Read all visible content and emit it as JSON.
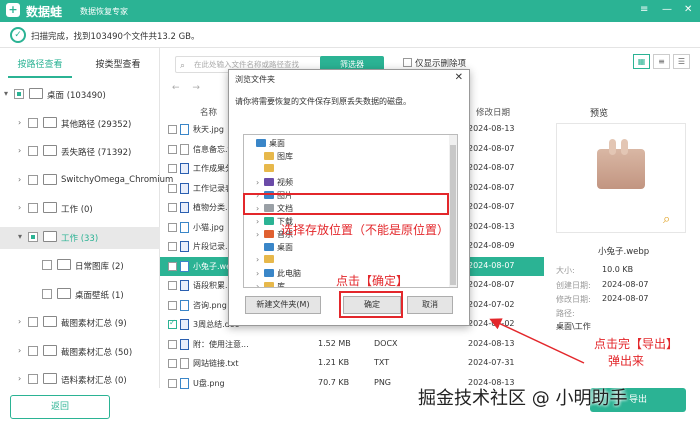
{
  "titlebar": {
    "logo_glyph": "+",
    "app_name": "数据蛙",
    "app_subtitle": "数据恢复专家",
    "controls": [
      "≡",
      "—",
      "✕"
    ]
  },
  "status": {
    "text": "扫描完成，找到103490个文件共13.2 GB。"
  },
  "tabs": [
    "按路径查看",
    "按类型查看"
  ],
  "tree": [
    {
      "label": "桌面 (103490)",
      "expand": "▾",
      "level": 0
    },
    {
      "label": "其他路径 (29352)",
      "expand": "›",
      "level": 1
    },
    {
      "label": "丢失路径 (71392)",
      "expand": "›",
      "level": 1
    },
    {
      "label": "SwitchyOmega_Chromium",
      "expand": "›",
      "level": 1
    },
    {
      "label": "工作 (0)",
      "expand": "›",
      "level": 1
    },
    {
      "label": "工作 (33)",
      "expand": "▾",
      "level": 1,
      "selected": true
    },
    {
      "label": "日常图库 (2)",
      "expand": "",
      "level": 2
    },
    {
      "label": "桌面壁纸 (1)",
      "expand": "",
      "level": 2
    },
    {
      "label": "截图素材汇总 (9)",
      "expand": "›",
      "level": 1
    },
    {
      "label": "截图素材汇总 (50)",
      "expand": "›",
      "level": 1
    },
    {
      "label": "语料素材汇总 (0)",
      "expand": "›",
      "level": 1
    }
  ],
  "back_button": "返回",
  "search": {
    "placeholder": "在此处输入文件名称或路径查找"
  },
  "filter_button": "筛选器",
  "only_deleted": "仅显示删除项",
  "nav": {
    "back": "←",
    "forward": "→"
  },
  "columns": {
    "name": "名称",
    "date": "修改日期"
  },
  "files": [
    {
      "name": "秋天.jpg",
      "size": "",
      "type": "",
      "date": "2024-08-13",
      "checked": false,
      "icon": "img"
    },
    {
      "name": "信息备忘.t",
      "size": "",
      "type": "",
      "date": "2024-08-07",
      "checked": false,
      "icon": "txt"
    },
    {
      "name": "工作成果分",
      "size": "",
      "type": "",
      "date": "2024-08-07",
      "checked": false,
      "icon": "doc"
    },
    {
      "name": "工作记录表",
      "size": "",
      "type": "",
      "date": "2024-08-07",
      "checked": false,
      "icon": "doc"
    },
    {
      "name": "植物分类.d",
      "size": "",
      "type": "",
      "date": "2024-08-07",
      "checked": false,
      "icon": "doc"
    },
    {
      "name": "小猫.jpg",
      "size": "",
      "type": "",
      "date": "2024-08-13",
      "checked": false,
      "icon": "img"
    },
    {
      "name": "片段记录.d",
      "size": "",
      "type": "",
      "date": "2024-08-09",
      "checked": false,
      "icon": "doc"
    },
    {
      "name": "小兔子.web",
      "size": "",
      "type": "",
      "date": "2024-08-07",
      "checked": false,
      "icon": "img",
      "selected": true
    },
    {
      "name": "语段积累.d",
      "size": "",
      "type": "",
      "date": "2024-08-07",
      "checked": false,
      "icon": "doc"
    },
    {
      "name": "咨询.png",
      "size": "",
      "type": "",
      "date": "2024-07-02",
      "checked": false,
      "icon": "img"
    },
    {
      "name": "3周总结.doc",
      "size": "",
      "type": "",
      "date": "2024-07-02",
      "checked": true,
      "icon": "doc"
    },
    {
      "name": "附：使用注意...",
      "size": "1.52 MB",
      "type": "DOCX",
      "date": "2024-08-13",
      "checked": false,
      "icon": "doc"
    },
    {
      "name": "网站链接.txt",
      "size": "1.21 KB",
      "type": "TXT",
      "date": "2024-07-31",
      "checked": false,
      "icon": "txt"
    },
    {
      "name": "U盘.png",
      "size": "70.7 KB",
      "type": "PNG",
      "date": "2024-08-13",
      "checked": false,
      "icon": "img"
    }
  ],
  "preview": {
    "title": "预览",
    "filename": "小兔子.webp",
    "meta": [
      {
        "key": "大小:",
        "value": "10.0 KB"
      },
      {
        "key": "创建日期:",
        "value": "2024-08-07"
      },
      {
        "key": "修改日期:",
        "value": "2024-08-07"
      },
      {
        "key": "路径:",
        "value": "桌面\\工作"
      }
    ]
  },
  "export_button": "导出",
  "dialog": {
    "title": "浏览文件夹",
    "message": "请你将需要恢复的文件保存到原丢失数据的磁盘。",
    "tree": [
      {
        "label": "桌面",
        "indent": 0,
        "arrow": "",
        "color": "#3a86c8"
      },
      {
        "label": "图库",
        "indent": 1,
        "arrow": "",
        "color": "#e7b84b"
      },
      {
        "label": "",
        "indent": 1,
        "arrow": "",
        "color": "#e7b84b"
      },
      {
        "label": "视频",
        "indent": 1,
        "arrow": "›",
        "color": "#6b4ba8"
      },
      {
        "label": "图片",
        "indent": 1,
        "arrow": "›",
        "color": "#3a86c8"
      },
      {
        "label": "文档",
        "indent": 1,
        "arrow": "›",
        "color": "#9aa0a6"
      },
      {
        "label": "下载",
        "indent": 1,
        "arrow": "›",
        "color": "#2bb394"
      },
      {
        "label": "音乐",
        "indent": 1,
        "arrow": "›",
        "color": "#e06030"
      },
      {
        "label": "桌面",
        "indent": 1,
        "arrow": "",
        "color": "#3a86c8"
      },
      {
        "label": "",
        "indent": 1,
        "arrow": "›",
        "color": "#e7b84b"
      },
      {
        "label": "此电脑",
        "indent": 1,
        "arrow": "›",
        "color": "#3a86c8"
      },
      {
        "label": "库",
        "indent": 1,
        "arrow": "›",
        "color": "#e7b84b"
      }
    ],
    "new_folder": "新建文件夹(M)",
    "ok": "确定",
    "cancel": "取消",
    "close": "✕"
  },
  "annotations": {
    "choose": "选择存放位置（不能是原位置）",
    "click_ok": "点击【确定】",
    "after_export_1": "点击完【导出】",
    "after_export_2": "弹出来"
  },
  "watermark": "掘金技术社区 @ 小明助手",
  "colors": {
    "accent": "#2bb394",
    "annotation": "#e3272b"
  }
}
